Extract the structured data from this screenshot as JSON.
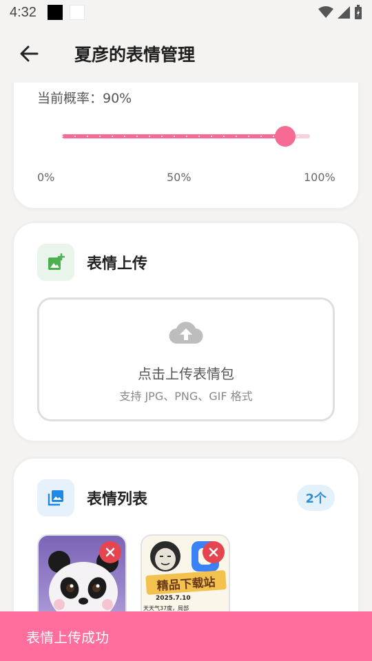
{
  "status_bar": {
    "time": "4:32"
  },
  "app_bar": {
    "title": "夏彦的表情管理",
    "back_icon": "arrow-left-icon"
  },
  "probability": {
    "label": "当前概率：90%",
    "value_percent": 90,
    "ticks": [
      "0%",
      "50%",
      "100%"
    ]
  },
  "upload": {
    "title": "表情上传",
    "icon": "add-photo-icon",
    "drop_title": "点击上传表情包",
    "drop_subtitle": "支持 JPG、PNG、GIF 格式"
  },
  "list": {
    "title": "表情列表",
    "icon": "photo-library-icon",
    "count": "2个",
    "items": [
      {
        "name": "panda",
        "delete_icon": "close-icon"
      },
      {
        "name": "store-banner",
        "banner_text": "精品下载站",
        "date_text": "2025.7.10",
        "caption_text": "天天气37度，局部",
        "delete_icon": "close-icon"
      }
    ]
  },
  "toast": {
    "message": "表情上传成功"
  },
  "colors": {
    "accent": "#f56b93",
    "toast": "#ff6e9c",
    "badge_text": "#2e8ed6",
    "delete": "#e5454f"
  }
}
